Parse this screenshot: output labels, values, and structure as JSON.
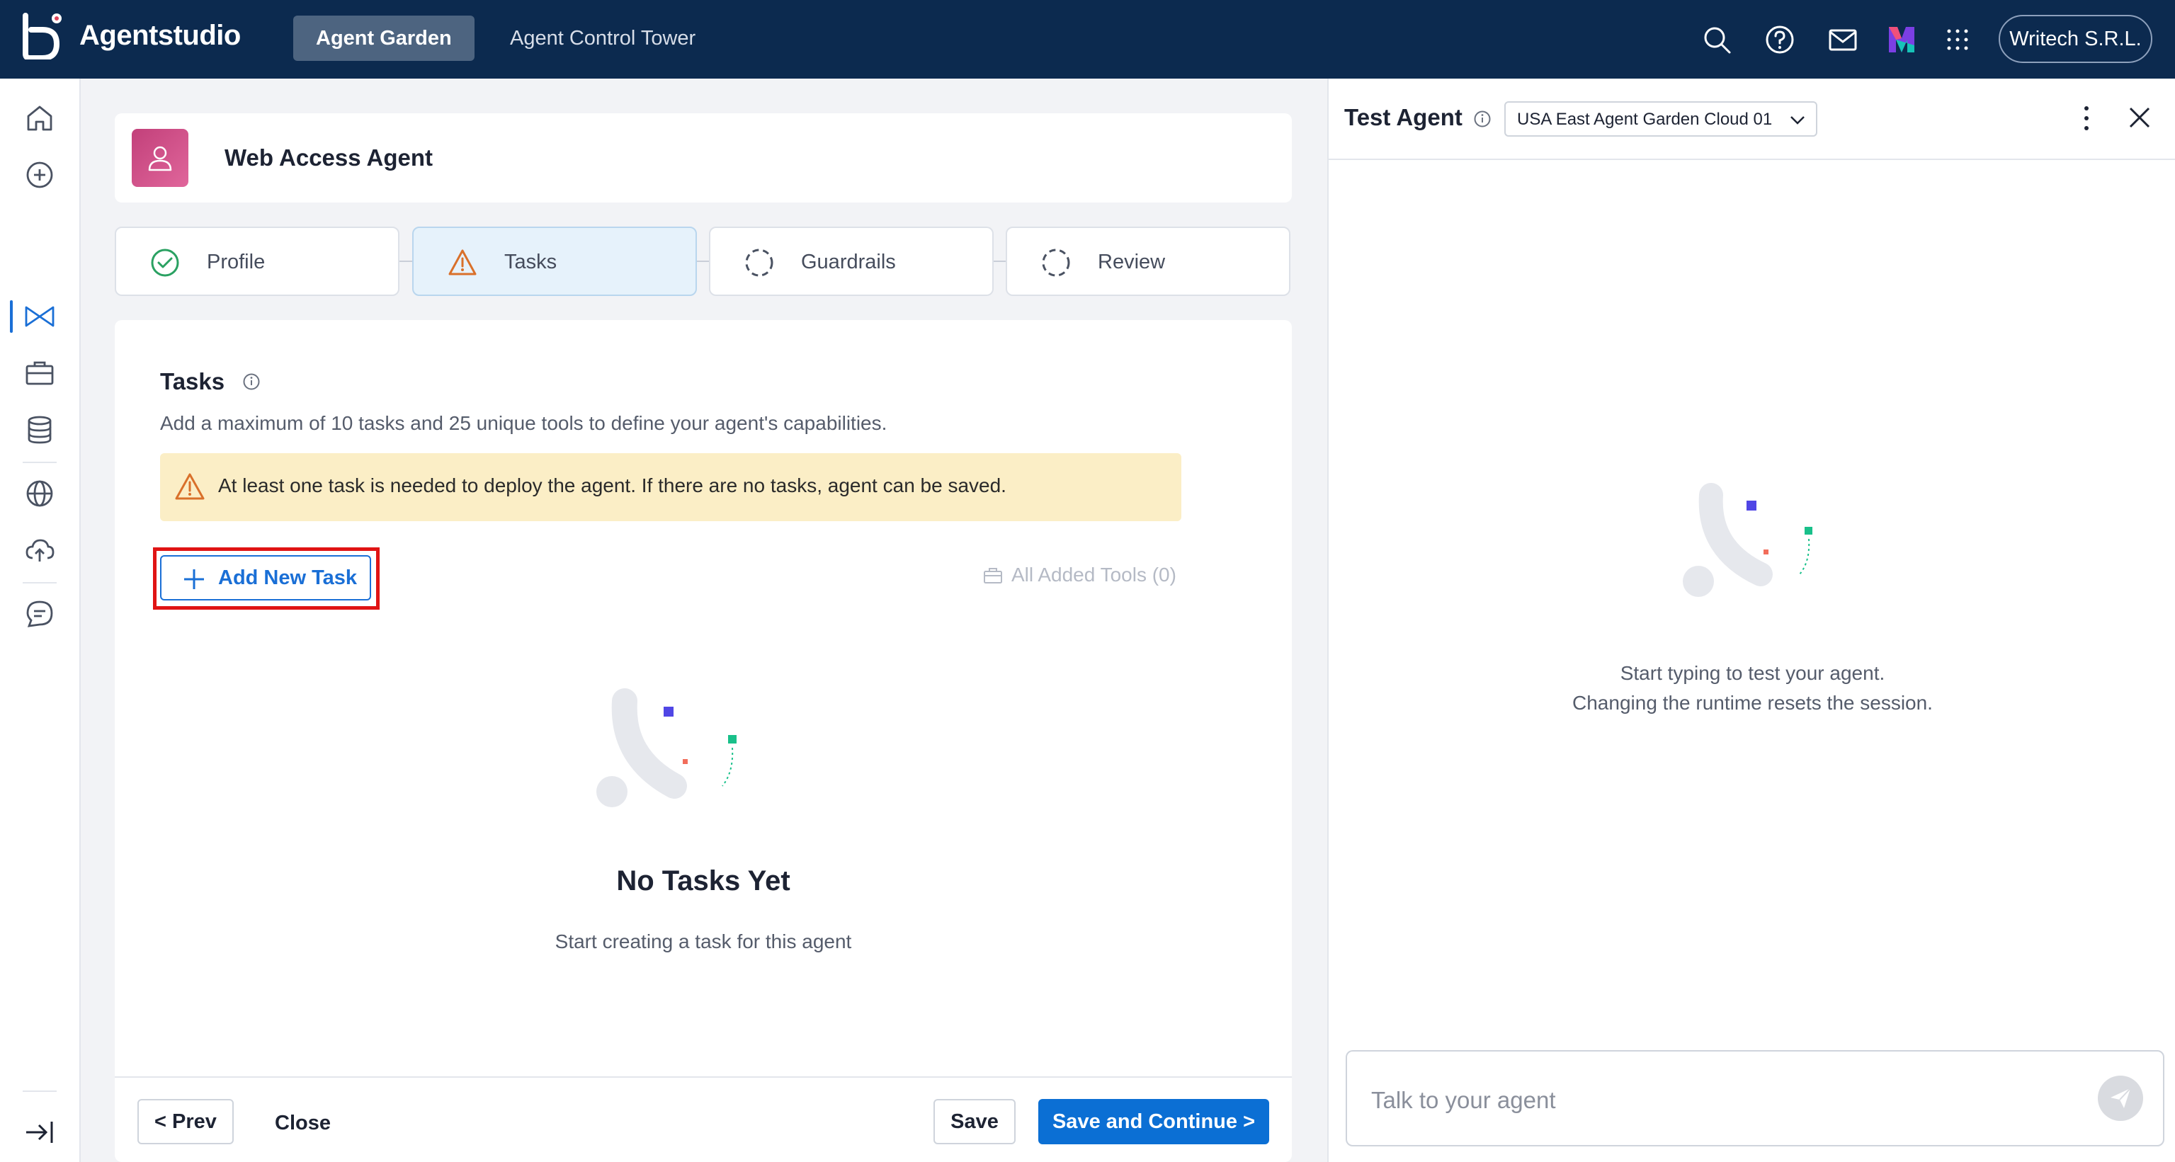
{
  "topbar": {
    "brand": "Agentstudio",
    "tabs": [
      {
        "label": "Agent Garden",
        "active": true
      },
      {
        "label": "Agent Control Tower",
        "active": false
      }
    ],
    "icons": [
      "search-icon",
      "help-icon",
      "mail-icon",
      "product-switch-icon",
      "apps-grid-icon"
    ],
    "org": "Writech S.R.L.",
    "bg_color": "#0c2a4f"
  },
  "leftrail": {
    "icons": [
      "home-icon",
      "add-icon",
      "agent-garden-icon",
      "toolkit-icon",
      "database-icon",
      "globe-icon",
      "cloud-upload-icon",
      "chat-icon"
    ],
    "active": "agent-garden-icon",
    "bottom_icon": "collapse-icon"
  },
  "agent": {
    "name": "Web Access Agent",
    "avatar_icon": "user-icon"
  },
  "steps": [
    {
      "label": "Profile",
      "state": "complete",
      "icon": "check-circle-icon"
    },
    {
      "label": "Tasks",
      "state": "warning",
      "icon": "warning-icon"
    },
    {
      "label": "Guardrails",
      "state": "pending",
      "icon": "dashed-circle-icon"
    },
    {
      "label": "Review",
      "state": "pending",
      "icon": "dashed-circle-icon"
    }
  ],
  "tasks": {
    "title": "Tasks",
    "description": "Add a maximum of 10 tasks and 25 unique tools to define your agent's capabilities.",
    "warning": "At least one task is needed to deploy the agent. If there are no tasks, agent can be saved.",
    "add_button": "Add New Task",
    "all_tools": "All Added Tools (0)",
    "empty_title": "No Tasks Yet",
    "empty_subtitle": "Start creating a task for this agent"
  },
  "footer": {
    "prev": "< Prev",
    "close": "Close",
    "save": "Save",
    "save_continue": "Save and Continue >"
  },
  "test_panel": {
    "title": "Test Agent",
    "runtime": "USA East Agent Garden Cloud 01",
    "message_line1": "Start typing to test your agent.",
    "message_line2": "Changing the runtime resets the session.",
    "input_placeholder": "Talk to your agent"
  },
  "colors": {
    "accent": "#0b6fd4",
    "warning_bg": "#fbeec6",
    "highlight": "#e01414",
    "success": "#2aa162"
  }
}
